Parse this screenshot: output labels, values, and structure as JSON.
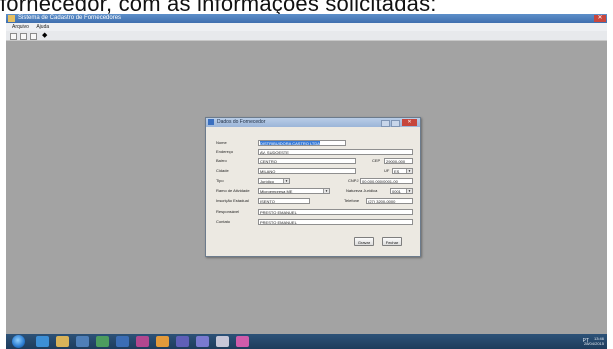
{
  "caption": "fornecedor, com as informações solicitadas:",
  "window": {
    "title": "Sistema de Cadastro de Fornecedores",
    "menus": [
      "Arquivo",
      "Ajuda"
    ],
    "close_glyph": "✕"
  },
  "dialog": {
    "title": "Dados do Fornecedor",
    "fields": {
      "nome": {
        "label": "Nome",
        "value": "DISTRIBUIDORA CASTRO LTDA"
      },
      "endereco": {
        "label": "Endereço",
        "value": "AV. SUDOESTE"
      },
      "bairro": {
        "label": "Bairro",
        "value": "CENTRO"
      },
      "cep": {
        "label": "CEP",
        "value": "29000-000"
      },
      "cidade": {
        "label": "Cidade",
        "value": "MILANO"
      },
      "uf": {
        "label": "UF",
        "value": "ES"
      },
      "tipo": {
        "label": "Tipo",
        "value": "Jurídico"
      },
      "cnpj": {
        "label": "CNPJ",
        "value": "00.000.000/0001-00"
      },
      "ramo_atividade": {
        "label": "Ramo de Atividade",
        "value": "Microempresa ME"
      },
      "natureza_juridica": {
        "label": "Natureza Jurídica",
        "value": "0001"
      },
      "inscricao_estadual": {
        "label": "Inscrição Estadual",
        "value": "ISENTO"
      },
      "telefone": {
        "label": "Telefone",
        "value": "(27) 3200-0000"
      },
      "responsavel": {
        "label": "Responsável",
        "value": "PRESTO EMANUEL"
      },
      "contato": {
        "label": "Contato",
        "value": "PRESTO EMANUEL"
      }
    },
    "buttons": {
      "save": "Gravar",
      "close": "Fechar"
    }
  },
  "taskbar": {
    "tray_text": "PT",
    "time": "13:46",
    "date": "28/04/2015"
  },
  "colors": {
    "workspace": "#a3a3a3",
    "titlebar": "#4a7cbd",
    "dialog": "#ece9e2",
    "selection": "#3479d8",
    "taskbar": "#244a6e"
  }
}
